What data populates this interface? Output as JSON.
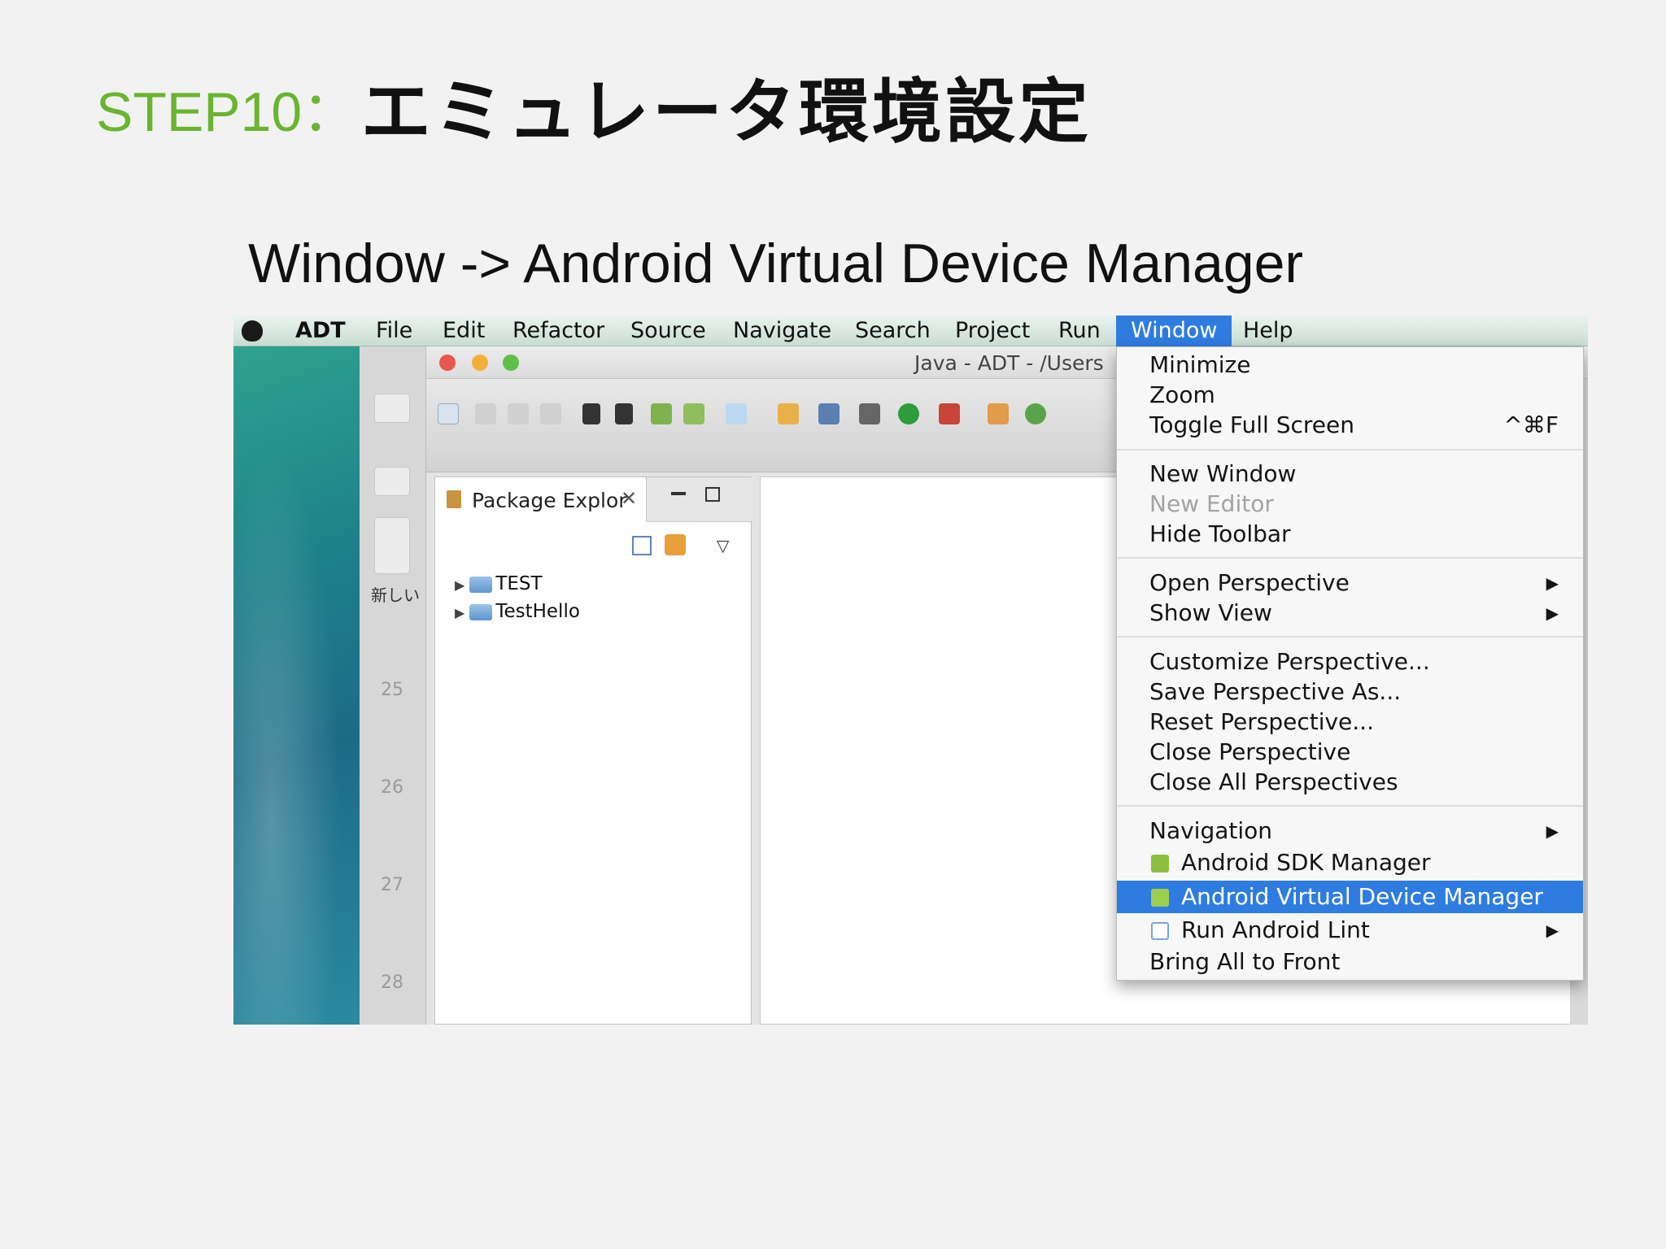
{
  "slide": {
    "title_prefix": "STEP10：",
    "title_main": "エミュレータ環境設定",
    "subtitle": "Window -> Android Virtual Device Manager"
  },
  "menubar": {
    "app": "ADT",
    "items": [
      "File",
      "Edit",
      "Refactor",
      "Source",
      "Navigate",
      "Search",
      "Project",
      "Run",
      "Window",
      "Help"
    ],
    "active": "Window"
  },
  "window": {
    "title": "Java - ADT - /Users"
  },
  "sidebar": {
    "new_label": "新しい",
    "line_numbers": [
      "25",
      "26",
      "27",
      "28"
    ]
  },
  "package_explorer": {
    "tab_label": "Package Explor",
    "close_glyph": "✕",
    "projects": [
      "TEST",
      "TestHello"
    ]
  },
  "window_menu": {
    "groups": [
      [
        {
          "label": "Minimize"
        },
        {
          "label": "Zoom"
        },
        {
          "label": "Toggle Full Screen",
          "shortcut": "^⌘F"
        }
      ],
      [
        {
          "label": "New Window"
        },
        {
          "label": "New Editor",
          "disabled": true
        },
        {
          "label": "Hide Toolbar"
        }
      ],
      [
        {
          "label": "Open Perspective",
          "submenu": true
        },
        {
          "label": "Show View",
          "submenu": true
        }
      ],
      [
        {
          "label": "Customize Perspective..."
        },
        {
          "label": "Save Perspective As..."
        },
        {
          "label": "Reset Perspective..."
        },
        {
          "label": "Close Perspective"
        },
        {
          "label": "Close All Perspectives"
        }
      ],
      [
        {
          "label": "Navigation",
          "submenu": true
        },
        {
          "label": "Android SDK Manager",
          "icon": "android-sdk-icon"
        },
        {
          "label": "Android Virtual Device Manager",
          "icon": "android-avd-icon",
          "highlighted": true
        },
        {
          "label": "Run Android Lint",
          "icon": "lint-check-icon",
          "submenu": true
        },
        {
          "label": "Bring All to Front"
        }
      ]
    ],
    "submenu_glyph": "▶"
  },
  "colors": {
    "title_green": "#6ab530",
    "selection_blue": "#2f7ce0"
  }
}
